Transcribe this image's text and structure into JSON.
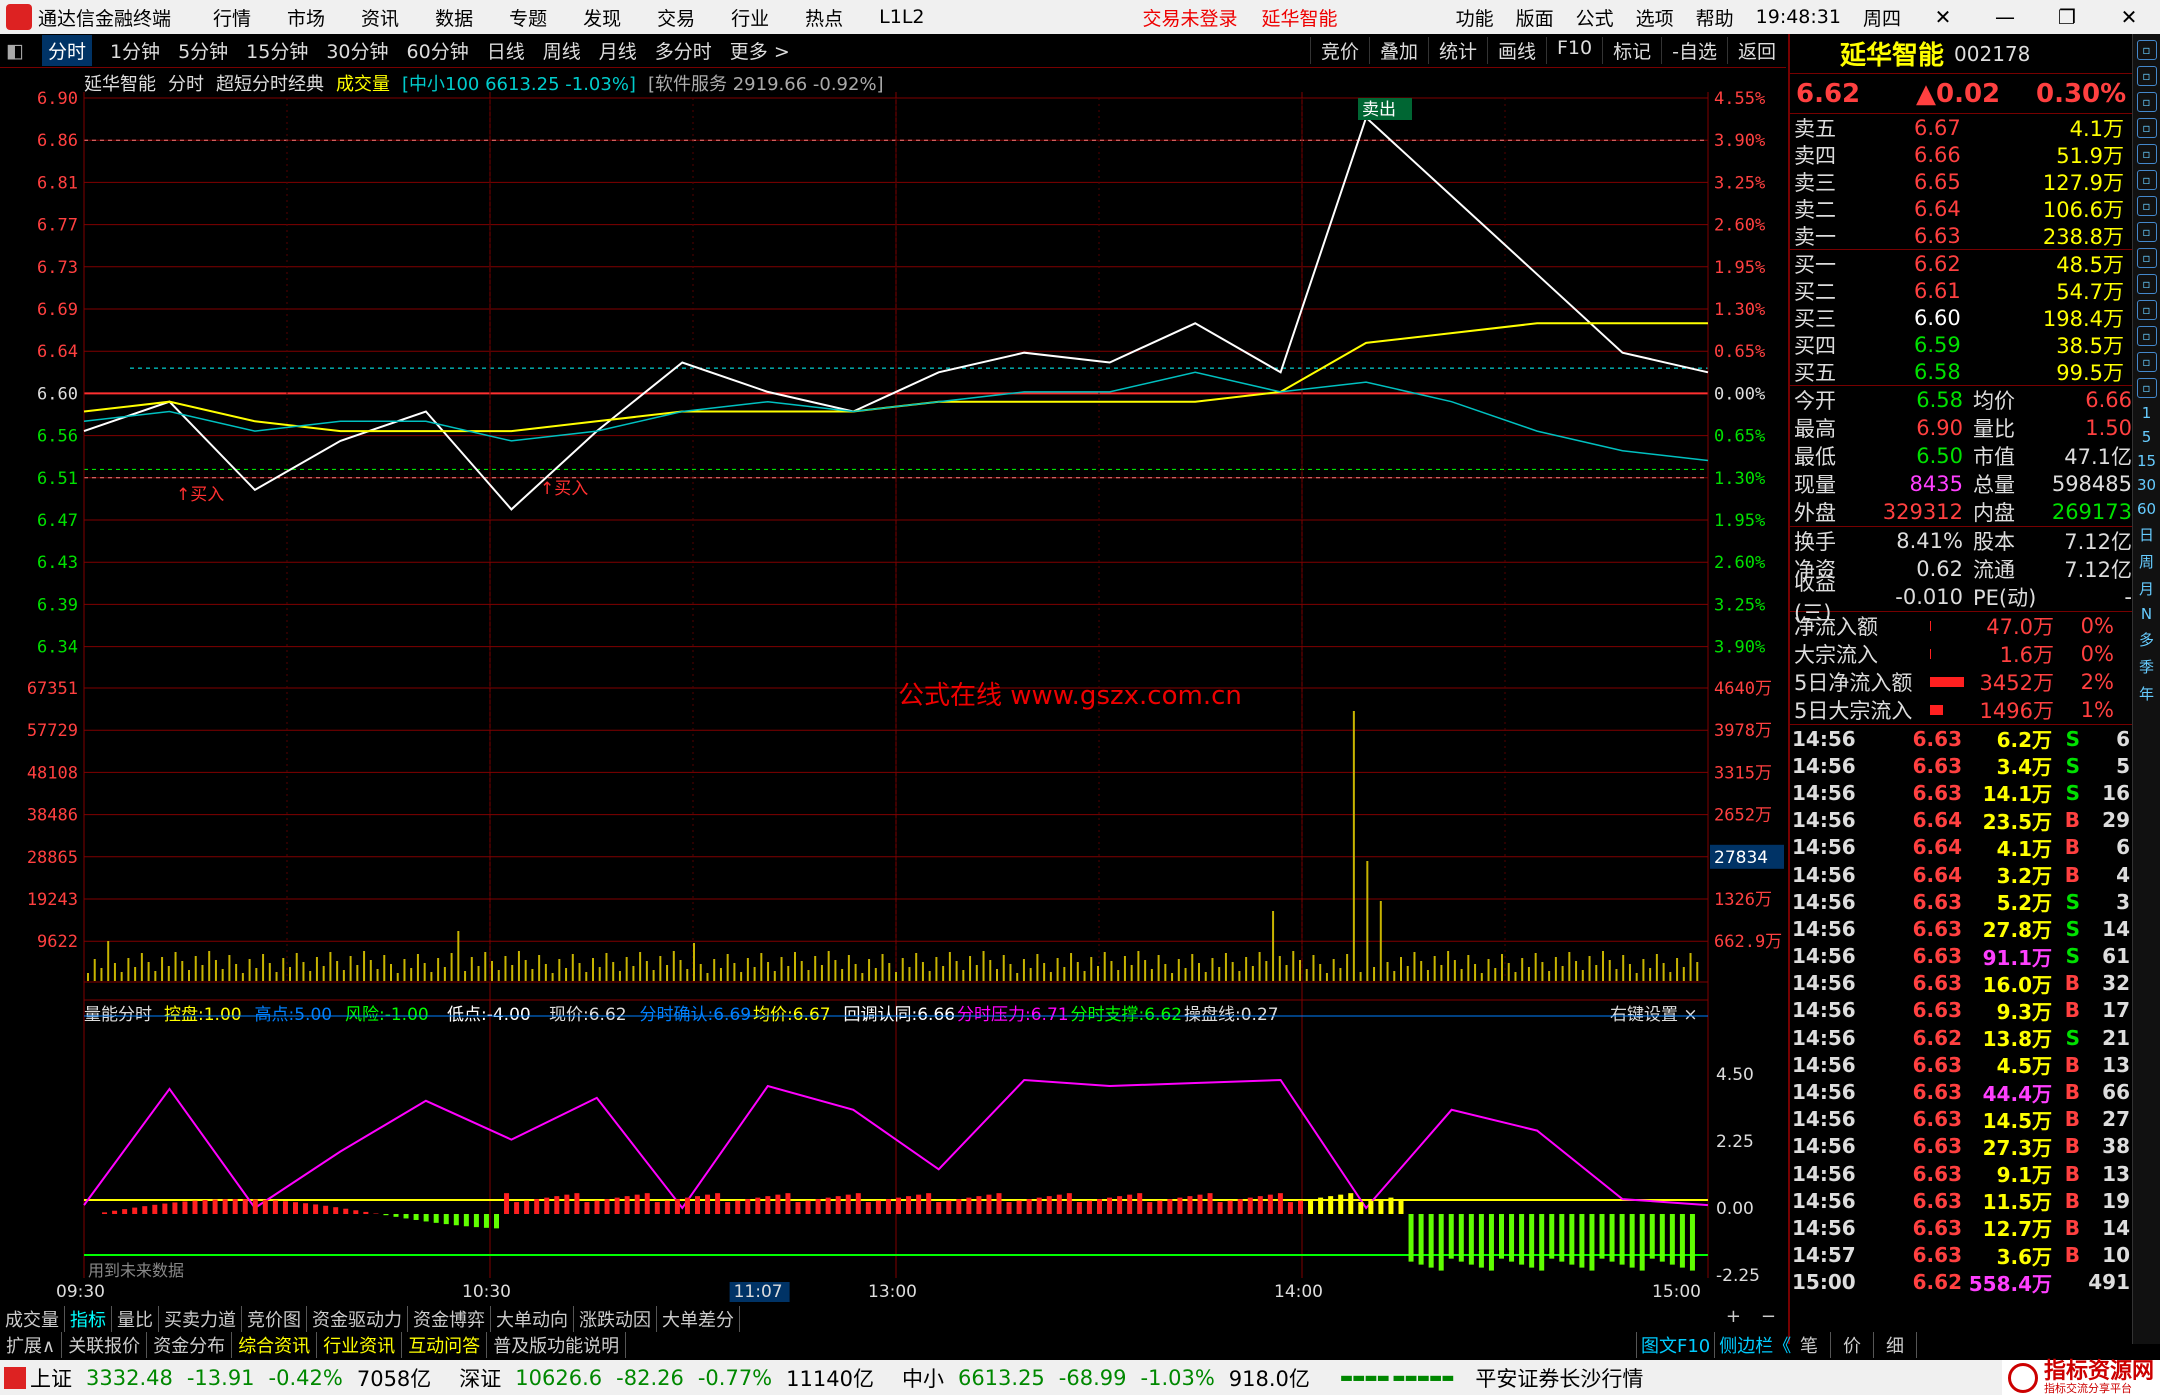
{
  "menu": {
    "app_name": "通达信金融终端",
    "items": [
      "行情",
      "市场",
      "资讯",
      "数据",
      "专题",
      "发现",
      "交易",
      "行业",
      "热点",
      "L1L2"
    ],
    "login_warning": "交易未登录",
    "stock_title": "延华智能",
    "right_items": [
      "功能",
      "版面",
      "公式",
      "选项",
      "帮助"
    ],
    "time": "19:48:31",
    "weekday": "周四"
  },
  "periods": {
    "tabs": [
      "分时",
      "1分钟",
      "5分钟",
      "15分钟",
      "30分钟",
      "60分钟",
      "日线",
      "周线",
      "月线",
      "多分时",
      "更多 >"
    ],
    "tools": [
      "竞价",
      "叠加",
      "统计",
      "画线",
      "F10",
      "标记",
      "-自选",
      "返回"
    ]
  },
  "chart_info": {
    "name": "延华智能",
    "view": "分时",
    "formula": "超短分时经典",
    "vol": "成交量",
    "overlay1": "[中小100 6613.25 -1.03%]",
    "overlay2": "[软件服务 2919.66 -0.92%]"
  },
  "price_axis": {
    "left": [
      "6.90",
      "6.86",
      "6.81",
      "6.77",
      "6.73",
      "6.69",
      "6.64",
      "6.60",
      "6.56",
      "6.51",
      "6.47",
      "6.43",
      "6.39",
      "6.34"
    ],
    "right": [
      "4.55%",
      "3.90%",
      "3.25%",
      "2.60%",
      "1.95%",
      "1.30%",
      "0.65%",
      "0.00%",
      "0.65%",
      "1.30%",
      "1.95%",
      "2.60%",
      "3.25%",
      "3.90%"
    ]
  },
  "volume_axis": {
    "left": [
      "67351",
      "57729",
      "48108",
      "38486",
      "28865",
      "19243",
      "9622"
    ],
    "right": [
      "4640万",
      "3978万",
      "3315万",
      "2652万",
      "1326万",
      "662.9万"
    ],
    "current": "27834"
  },
  "markers": {
    "buy": "买入",
    "sell": "卖出"
  },
  "watermark": "公式在线  www.gszx.com.cn",
  "indicator": {
    "title": "量能分时",
    "items": [
      {
        "label": "控盘:",
        "value": "1.00",
        "color": "#ffff00"
      },
      {
        "label": "高点:",
        "value": "5.00",
        "color": "#0080ff"
      },
      {
        "label": "风险:",
        "value": "-1.00",
        "color": "#00ff00"
      },
      {
        "label": "低点:",
        "value": "-4.00",
        "color": "#ffffff"
      },
      {
        "label": "现价:",
        "value": "6.62",
        "color": "#dddddd"
      },
      {
        "label": "分时确认:",
        "value": "6.69",
        "color": "#0080ff"
      },
      {
        "label": "均价:",
        "value": "6.67",
        "color": "#ffff00"
      },
      {
        "label": "回调认同:",
        "value": "6.66",
        "color": "#ffffff"
      },
      {
        "label": "分时压力:",
        "value": "6.71",
        "color": "#ff00ff"
      },
      {
        "label": "分时支撑:",
        "value": "6.62",
        "color": "#00ff00"
      },
      {
        "label": "操盘线:",
        "value": "0.27",
        "color": "#dddddd"
      }
    ],
    "settings": "右键设置",
    "axis": [
      "4.50",
      "2.25",
      "0.00",
      "-2.25"
    ],
    "note": "用到未来数据"
  },
  "time_axis": [
    "09:30",
    "10:30",
    "11:07",
    "13:00",
    "14:00",
    "15:00"
  ],
  "chart_data": {
    "type": "line",
    "title": "延华智能 分时",
    "x": [
      "09:30",
      "10:30",
      "11:30/13:00",
      "14:00",
      "15:00"
    ],
    "ylim": [
      6.3,
      6.9
    ],
    "prev_close": 6.6,
    "series": [
      {
        "name": "现价",
        "values": [
          6.56,
          6.59,
          6.5,
          6.55,
          6.58,
          6.48,
          6.56,
          6.63,
          6.6,
          6.58,
          6.62,
          6.64,
          6.63,
          6.67,
          6.62,
          6.88,
          6.8,
          6.72,
          6.64,
          6.62
        ]
      },
      {
        "name": "均价",
        "values": [
          6.58,
          6.59,
          6.57,
          6.56,
          6.56,
          6.56,
          6.57,
          6.58,
          6.58,
          6.58,
          6.59,
          6.59,
          6.59,
          6.59,
          6.6,
          6.65,
          6.66,
          6.67,
          6.67,
          6.67
        ]
      }
    ]
  },
  "quote": {
    "name": "延华智能",
    "code": "002178",
    "price": "6.62",
    "change": "▲0.02",
    "pct": "0.30%",
    "asks": [
      {
        "label": "卖五",
        "price": "6.67",
        "vol": "4.1万",
        "pcolor": "#ff4040"
      },
      {
        "label": "卖四",
        "price": "6.66",
        "vol": "51.9万",
        "pcolor": "#ff4040"
      },
      {
        "label": "卖三",
        "price": "6.65",
        "vol": "127.9万",
        "pcolor": "#ff4040"
      },
      {
        "label": "卖二",
        "price": "6.64",
        "vol": "106.6万",
        "pcolor": "#ff4040"
      },
      {
        "label": "卖一",
        "price": "6.63",
        "vol": "238.8万",
        "pcolor": "#ff4040"
      }
    ],
    "bids": [
      {
        "label": "买一",
        "price": "6.62",
        "vol": "48.5万",
        "pcolor": "#ff4040"
      },
      {
        "label": "买二",
        "price": "6.61",
        "vol": "54.7万",
        "pcolor": "#ff4040"
      },
      {
        "label": "买三",
        "price": "6.60",
        "vol": "198.4万",
        "pcolor": "#ffffff"
      },
      {
        "label": "买四",
        "price": "6.59",
        "vol": "38.5万",
        "pcolor": "#00e000"
      },
      {
        "label": "买五",
        "price": "6.58",
        "vol": "99.5万",
        "pcolor": "#00e000"
      }
    ],
    "stats": [
      [
        "今开",
        "6.58",
        "#00e000",
        "均价",
        "6.66",
        "#ff4040"
      ],
      [
        "最高",
        "6.90",
        "#ff4040",
        "量比",
        "1.50",
        "#ff4040"
      ],
      [
        "最低",
        "6.50",
        "#00e000",
        "市值",
        "47.1亿",
        "#dddddd"
      ],
      [
        "现量",
        "8435",
        "#ff40ff",
        "总量",
        "598485",
        "#dddddd"
      ],
      [
        "外盘",
        "329312",
        "#ff4040",
        "内盘",
        "269173",
        "#00e000"
      ]
    ],
    "stats2": [
      [
        "换手",
        "8.41%",
        "#dddddd",
        "股本",
        "7.12亿",
        "#dddddd"
      ],
      [
        "净资",
        "0.62",
        "#dddddd",
        "流通",
        "7.12亿",
        "#dddddd"
      ],
      [
        "收益(三)",
        "-0.010",
        "#dddddd",
        "PE(动)",
        "-",
        "#dddddd"
      ]
    ],
    "flows": [
      {
        "label": "净流入额",
        "value": "47.0万",
        "pct": "0%",
        "bar": 0.02
      },
      {
        "label": "大宗流入",
        "value": "1.6万",
        "pct": "0%",
        "bar": 0.02
      },
      {
        "label": "5日净流入额",
        "value": "3452万",
        "pct": "2%",
        "bar": 0.9
      },
      {
        "label": "5日大宗流入",
        "value": "1496万",
        "pct": "1%",
        "bar": 0.35
      }
    ],
    "ticks": [
      [
        "14:56",
        "6.63",
        "6.2万",
        "S",
        "6"
      ],
      [
        "14:56",
        "6.63",
        "3.4万",
        "S",
        "5"
      ],
      [
        "14:56",
        "6.63",
        "14.1万",
        "S",
        "16"
      ],
      [
        "14:56",
        "6.64",
        "23.5万",
        "B",
        "29"
      ],
      [
        "14:56",
        "6.64",
        "4.1万",
        "B",
        "6"
      ],
      [
        "14:56",
        "6.64",
        "3.2万",
        "B",
        "4"
      ],
      [
        "14:56",
        "6.63",
        "5.2万",
        "S",
        "3"
      ],
      [
        "14:56",
        "6.63",
        "27.8万",
        "S",
        "14"
      ],
      [
        "14:56",
        "6.63",
        "91.1万",
        "S",
        "61"
      ],
      [
        "14:56",
        "6.63",
        "16.0万",
        "B",
        "32"
      ],
      [
        "14:56",
        "6.63",
        "9.3万",
        "B",
        "17"
      ],
      [
        "14:56",
        "6.62",
        "13.8万",
        "S",
        "21"
      ],
      [
        "14:56",
        "6.63",
        "4.5万",
        "B",
        "13"
      ],
      [
        "14:56",
        "6.63",
        "44.4万",
        "B",
        "66"
      ],
      [
        "14:56",
        "6.63",
        "14.5万",
        "B",
        "27"
      ],
      [
        "14:56",
        "6.63",
        "27.3万",
        "B",
        "38"
      ],
      [
        "14:56",
        "6.63",
        "9.1万",
        "B",
        "13"
      ],
      [
        "14:56",
        "6.63",
        "11.5万",
        "B",
        "19"
      ],
      [
        "14:56",
        "6.63",
        "12.7万",
        "B",
        "14"
      ],
      [
        "14:57",
        "6.63",
        "3.6万",
        "B",
        "10"
      ],
      [
        "15:00",
        "6.62",
        "558.4万",
        "",
        "491"
      ]
    ],
    "tick_highlight": [
      8,
      13,
      20
    ]
  },
  "sidebar_labels": [
    "1",
    "5",
    "15",
    "30",
    "60",
    "日",
    "周",
    "月",
    "N",
    "多",
    "季",
    "年"
  ],
  "bottom_tabs1": [
    "成交量",
    "指标",
    "量比",
    "买卖力道",
    "竞价图",
    "资金驱动力",
    "资金博弈",
    "大单动向",
    "涨跌动因",
    "大单差分"
  ],
  "bottom_tabs2": [
    "扩展∧",
    "关联报价",
    "资金分布",
    "综合资讯",
    "行业资讯",
    "互动问答",
    "普及版功能说明"
  ],
  "bottom_right": [
    "图文F10",
    "侧边栏《",
    "笔",
    "价",
    "细"
  ],
  "statusbar": {
    "sh_label": "上证",
    "sh_val": "3332.48",
    "sh_chg": "-13.91",
    "sh_pct": "-0.42%",
    "sh_amt": "7058亿",
    "sz_label": "深证",
    "sz_val": "10626.6",
    "sz_chg": "-82.26",
    "sz_pct": "-0.77%",
    "sz_amt": "11140亿",
    "zx_label": "中小",
    "zx_val": "6613.25",
    "zx_chg": "-68.99",
    "zx_pct": "-1.03%",
    "zx_amt": "918.0亿",
    "broker": "平安证券长沙行情",
    "brand": "指标资源网",
    "brand_sub": "指标交流分享平台"
  },
  "colors": {
    "up": "#ff4040",
    "down": "#00e000",
    "grid": "#800000",
    "avg": "#ffff00"
  }
}
